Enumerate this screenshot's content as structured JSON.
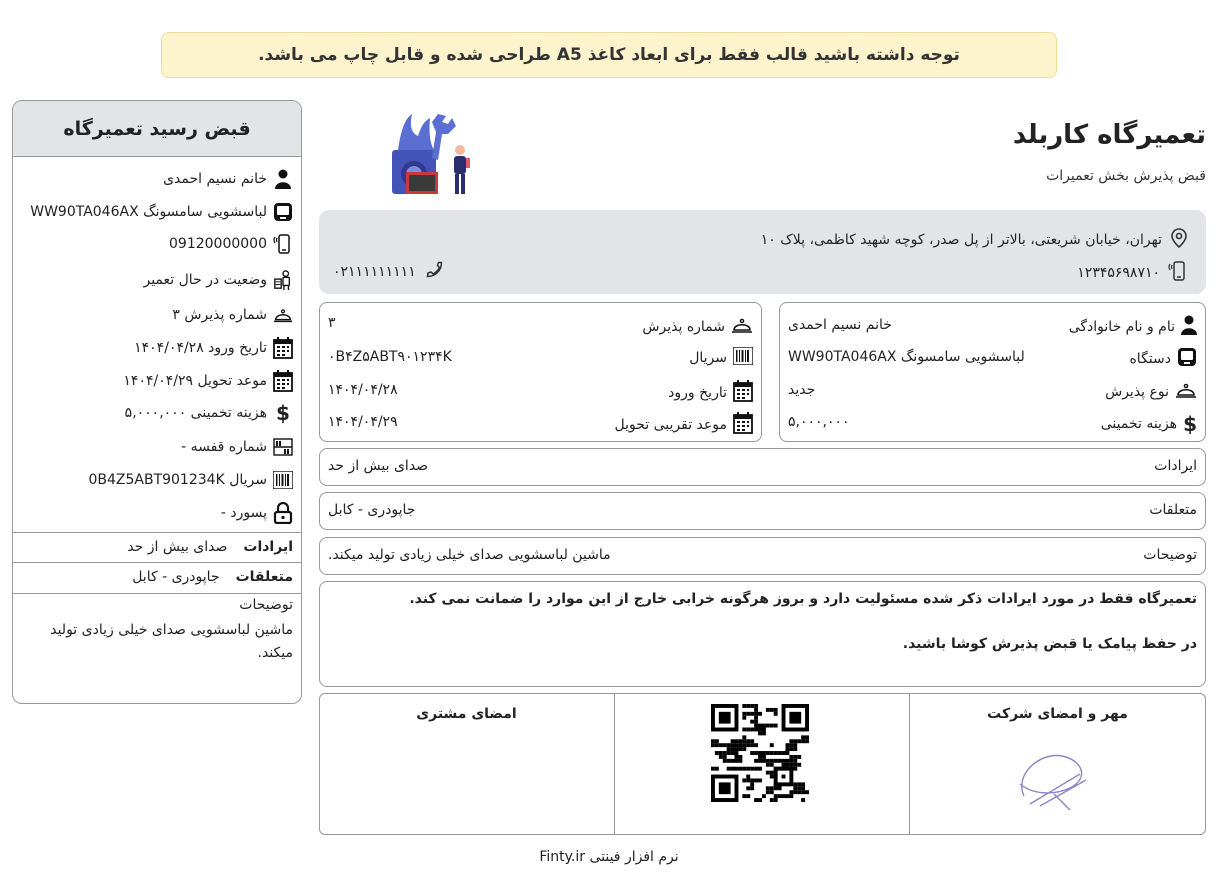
{
  "notice": "توجه داشته باشید قالب فقط برای ابعاد کاغذ A5 طراحی شده و قابل چاپ می باشد.",
  "summary": {
    "title": "قبض رسید تعمیرگاه",
    "customer": "خانم نسیم احمدی",
    "device": "لباسشویی سامسونگ WW90TA046AX",
    "phone": "09120000000",
    "status": "وضعیت در حال تعمیر",
    "receipt_no": "شماره پذیرش ۳",
    "entry_date": "تاریخ ورود ۱۴۰۴/۰۴/۲۸",
    "delivery_date": "موعد تحویل ۱۴۰۴/۰۴/۲۹",
    "estimate": "هزینه تخمینی ۵,۰۰۰,۰۰۰",
    "shelf": "شماره قفسه -",
    "serial": "سریال 0B4Z5ABT901234K",
    "password": "پسورد -",
    "issues_label": "ایرادات",
    "issues_value": "صدای بیش از حد",
    "accessories_label": "متعلقات",
    "accessories_value": "جاپودری - کابل",
    "notes_label": "توضیحات",
    "notes_value": "ماشین لباسشویی صدای خیلی زیادی تولید میکند."
  },
  "shop": {
    "name": "تعمیرگاه کاربلد",
    "subtitle": "قبض پذیرش بخش تعمیرات",
    "address": "تهران، خیابان شریعتی، بالاتر از پل صدر، کوچه شهید کاظمی، پلاک ۱۰",
    "mobile": "۱۲۳۴۵۶۹۸۷۱۰",
    "landline": "۰۲۱۱۱۱۱۱۱۱۱"
  },
  "details_right": {
    "name_label": "نام و نام خانوادگی",
    "name_value": "خانم نسیم احمدی",
    "device_label": "دستگاه",
    "device_value": "لباسشویی سامسونگ WW90TA046AX",
    "type_label": "نوع پذیرش",
    "type_value": "جدید",
    "cost_label": "هزینه تخمینی",
    "cost_value": "۵,۰۰۰,۰۰۰"
  },
  "details_left": {
    "receipt_label": "شماره پذیرش",
    "receipt_value": "۳",
    "serial_label": "سریال",
    "serial_value": "۰B۴Z۵ABT۹۰۱۲۳۴K",
    "entry_label": "تاریخ ورود",
    "entry_value": "۱۴۰۴/۰۴/۲۸",
    "delivery_label": "موعد تقریبی تحویل",
    "delivery_value": "۱۴۰۴/۰۴/۲۹"
  },
  "rows": {
    "issues_label": "ایرادات",
    "issues_value": "صدای بیش از حد",
    "accessories_label": "متعلقات",
    "accessories_value": "جاپودری - کابل",
    "notes_label": "توضیحات",
    "notes_value": "ماشین لباسشویی صدای خیلی زیادی تولید میکند."
  },
  "terms": {
    "line1": "تعمیرگاه فقط در مورد ایرادات ذکر شده مسئولیت دارد و بروز هرگونه خرابی خارج از این موارد را ضمانت نمی کند.",
    "line2": "در حفظ پیامک یا قبض پذیرش کوشا باشید."
  },
  "signatures": {
    "company": "مهر و امضای شرکت",
    "customer": "امضای مشتری"
  },
  "footer": "نرم افزار فینتی Finty.ir"
}
